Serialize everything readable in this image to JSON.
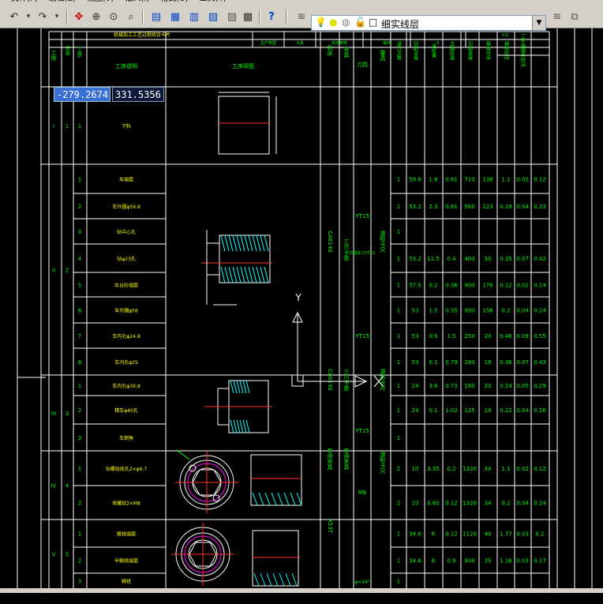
{
  "menubar": {
    "items": [
      "文件(F)",
      "编辑(E)",
      "视图(V)",
      "插入(I)",
      "格式(O)",
      "工具(T)"
    ]
  },
  "toolbar": {
    "layer_name": "细实线层",
    "icons": [
      "undo-icon",
      "redo-icon",
      "pan-icon",
      "zoom-realtime-icon",
      "zoom-window-icon",
      "zoom-previous-icon",
      "properties-icon",
      "design-center-icon",
      "tool-palette-icon",
      "calculator-icon",
      "help-icon",
      "layer-manager-icon",
      "layer-state-icon"
    ]
  },
  "coords": {
    "x": "-279.2674",
    "y": "331.5356"
  },
  "colors": {
    "line": "#ffffff",
    "text": "#00ff00",
    "yellow": "#ffff00",
    "magenta": "#ff00ff",
    "cyan": "#00ffff",
    "red": "#ff3030",
    "blue": "#4060ff"
  },
  "drawing": {
    "header": {
      "process_name": "机械加工工艺过程综合卡片",
      "col_labels": [
        "工序",
        "安装",
        "工步",
        "工序说明",
        "工序简图",
        "机床",
        "夹具",
        "刀具",
        "量具",
        "进刀次数",
        "切削深度",
        "进给量",
        "主轴转速",
        "切削速度",
        "基本时间",
        "辅助时间",
        "工作地服务时间"
      ],
      "sub_labels": [
        "生产类型",
        "大批",
        "毛坯种类",
        "锻件"
      ],
      "top_values": [
        "3",
        "2.2"
      ]
    },
    "operations": [
      {
        "op": "I",
        "setup": "1",
        "steps": [
          {
            "no": "1",
            "desc": "下料",
            "vals": []
          }
        ]
      },
      {
        "op": "II",
        "setup": "2",
        "steps": [
          {
            "no": "1",
            "desc": "车端面",
            "vals": [
              "1",
              "59.8",
              "1.6",
              "0.61",
              "710",
              "138",
              "1.1",
              "0.02",
              "0.12"
            ]
          },
          {
            "no": "2",
            "desc": "车外圆φ59.8",
            "vals": [
              "1",
              "53.2",
              "2.3",
              "0.61",
              "560",
              "123",
              "0.19",
              "0.04",
              "0.23"
            ]
          },
          {
            "no": "3",
            "desc": "钻中心孔",
            "vals": [
              "1"
            ]
          },
          {
            "no": "4",
            "desc": "钻φ23孔",
            "vals": [
              "1",
              "53.2",
              "11.5",
              "0.4",
              "400",
              "30",
              "0.35",
              "0.07",
              "0.42"
            ]
          },
          {
            "no": "5",
            "desc": "车台阶端面",
            "vals": [
              "1",
              "57.5",
              "0.2",
              "0.36",
              "900",
              "176",
              "0.12",
              "0.02",
              "0.14"
            ]
          },
          {
            "no": "6",
            "desc": "车外圆φ56",
            "vals": [
              "1",
              "53",
              "1.5",
              "0.35",
              "900",
              "156",
              "0.2",
              "0.04",
              "0.24"
            ]
          },
          {
            "no": "7",
            "desc": "车内孔φ24.8",
            "vals": [
              "1",
              "53",
              "0.9",
              "1.5",
              "250",
              "20",
              "0.46",
              "0.09",
              "0.55"
            ]
          },
          {
            "no": "8",
            "desc": "车内孔φ25",
            "vals": [
              "1",
              "53",
              "0.1",
              "0.79",
              "280",
              "18",
              "0.36",
              "0.07",
              "0.43"
            ]
          }
        ]
      },
      {
        "op": "III",
        "setup": "3",
        "steps": [
          {
            "no": "1",
            "desc": "车内孔φ39.8",
            "vals": [
              "1",
              "24",
              "3.6",
              "0.73",
              "160",
              "20",
              "0.24",
              "0.05",
              "0.29"
            ]
          },
          {
            "no": "2",
            "desc": "精车φ40孔",
            "vals": [
              "1",
              "24",
              "0.1",
              "1.02",
              "125",
              "18",
              "0.22",
              "0.04",
              "0.26"
            ]
          },
          {
            "no": "3",
            "desc": "车倒角",
            "vals": [
              "1"
            ]
          }
        ]
      },
      {
        "op": "IV",
        "setup": "4",
        "steps": [
          {
            "no": "1",
            "desc": "钻螺纹底孔2×φ6.7",
            "vals": [
              "2",
              "10",
              "3.35",
              "0.2",
              "1320",
              "34",
              "1.1",
              "0.02",
              "0.12"
            ]
          },
          {
            "no": "2",
            "desc": "攻螺纹2×M8",
            "vals": [
              "2",
              "10",
              "0.65",
              "0.12",
              "1320",
              "34",
              "0.2",
              "0.04",
              "0.24"
            ]
          }
        ]
      },
      {
        "op": "V",
        "setup": "5",
        "steps": [
          {
            "no": "1",
            "desc": "粗铣端面",
            "vals": [
              "1",
              "34.6",
              "6",
              "0.12",
              "1120",
              "40",
              "1.77",
              "0.03",
              "0.2"
            ]
          },
          {
            "no": "2",
            "desc": "半精铣端面",
            "vals": [
              "1",
              "34.6",
              "6",
              "0.9",
              "900",
              "35",
              "1.16",
              "0.03",
              "0.17"
            ]
          },
          {
            "no": "3",
            "desc": "精铣",
            "vals": [
              "1"
            ]
          }
        ]
      }
    ],
    "machines": [
      "CA6140",
      "CA6140",
      "专用夹具",
      "X53T"
    ],
    "fixtures": [
      "三爪卡盘",
      "三爪卡盘",
      "专用夹具"
    ],
    "tools": [
      "YT15",
      "YT15",
      "YT15",
      "M8",
      "φ=34°",
      "外圆车刀YT15"
    ],
    "gauges": [
      "游标卡尺",
      "游标卡尺",
      "游标卡尺"
    ],
    "drawing_label_y": "Y"
  }
}
